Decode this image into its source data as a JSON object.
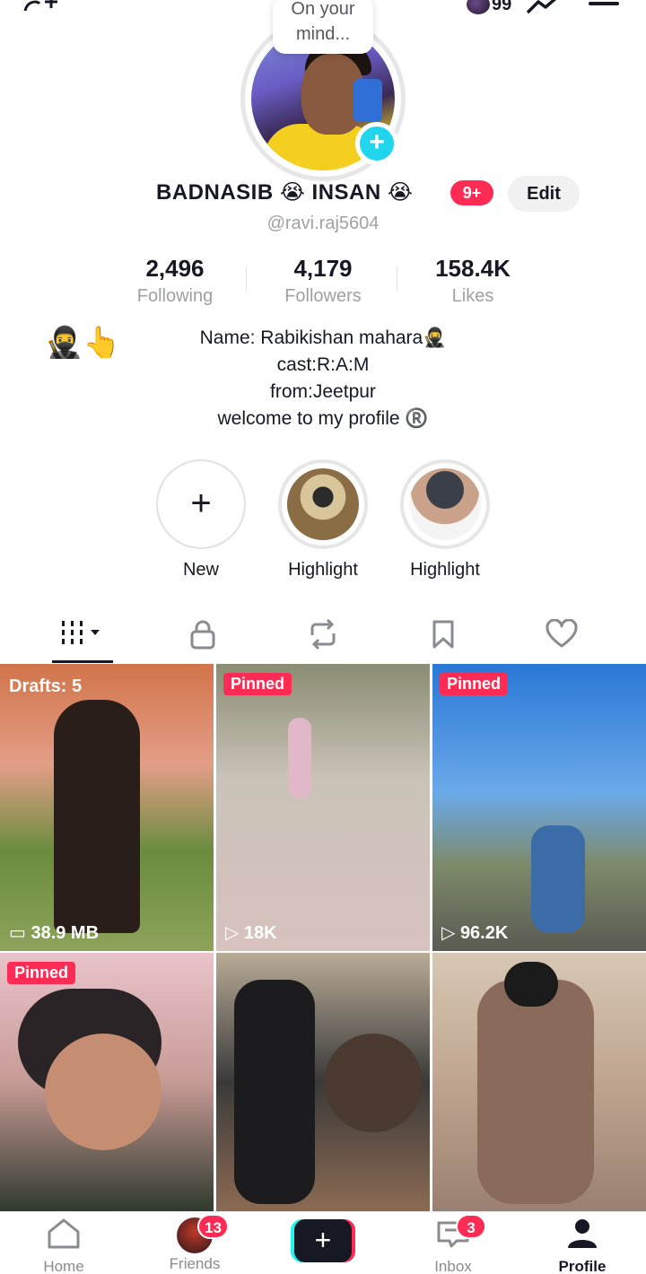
{
  "top_bar": {
    "notification_count": "99"
  },
  "avatar": {
    "thought_line1": "On your",
    "thought_line2": "mind..."
  },
  "profile": {
    "display_name": "BADNASIB 😭 INSAN 😭",
    "badge": "9+",
    "edit_label": "Edit",
    "username": "@ravi.raj5604"
  },
  "stats": [
    {
      "value": "2,496",
      "label": "Following"
    },
    {
      "value": "4,179",
      "label": "Followers"
    },
    {
      "value": "158.4K",
      "label": "Likes"
    }
  ],
  "bio": {
    "emoji": "🥷👆",
    "lines": [
      "Name: Rabikishan mahara🥷",
      "cast:R:A:M",
      "from:Jeetpur",
      "welcome to my profile ®️"
    ]
  },
  "highlights": [
    {
      "label": "New",
      "icon": "plus-icon"
    },
    {
      "label": "Highlight"
    },
    {
      "label": "Highlight"
    }
  ],
  "tabs": [
    {
      "icon": "grid-icon",
      "active": true
    },
    {
      "icon": "lock-icon"
    },
    {
      "icon": "repost-icon"
    },
    {
      "icon": "bookmark-icon"
    },
    {
      "icon": "heart-icon"
    }
  ],
  "videos": [
    {
      "tag": "Drafts: 5",
      "count": "38.9 MB",
      "count_icon": "storage-icon"
    },
    {
      "tag": "Pinned",
      "count": "18K",
      "count_icon": "play-icon"
    },
    {
      "tag": "Pinned",
      "count": "96.2K",
      "count_icon": "play-icon"
    },
    {
      "tag": "Pinned",
      "count": ""
    },
    {
      "tag": "",
      "count": ""
    },
    {
      "tag": "",
      "count": ""
    }
  ],
  "bottom_nav": {
    "home": "Home",
    "friends": "Friends",
    "friends_badge": "13",
    "inbox": "Inbox",
    "inbox_badge": "3",
    "profile": "Profile"
  },
  "colors": {
    "accent": "#fe2c55",
    "cyan": "#25f4ee",
    "plus": "#20d5ec"
  }
}
